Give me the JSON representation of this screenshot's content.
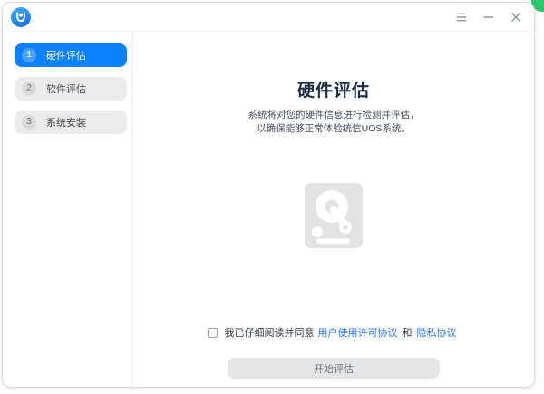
{
  "colors": {
    "accent_blue": "#0b81ff",
    "active_step_circle_blue": "#4aa0ff",
    "link_blue": "#2878ff",
    "inactive_step_bg": "#ebebeb",
    "disabled_button_bg": "#e4e5e7",
    "disabled_button_text": "#6e7683",
    "window_bg": "#ffffff",
    "artifact_green": "#2fc76d"
  },
  "titlebar": {
    "logo_icon": "uos-logo-icon",
    "menu_icon": "menu-icon",
    "minimize_icon": "minimize-icon",
    "close_icon": "close-icon"
  },
  "sidebar": {
    "steps": [
      {
        "number": "1",
        "label": "硬件评估",
        "state": "active"
      },
      {
        "number": "2",
        "label": "软件评估",
        "state": "inactive"
      },
      {
        "number": "3",
        "label": "系统安装",
        "state": "inactive"
      }
    ]
  },
  "main": {
    "title": "硬件评估",
    "description": [
      "系统将对您的硬件信息进行检测并评估，",
      "以确保能够正常体验统信UOS系统。"
    ],
    "center_icon": "hard-drive-search-icon",
    "agreement": {
      "checked": false,
      "prefix": "我已仔细阅读并同意",
      "license_link": "用户使用许可协议",
      "conjunction": "和",
      "privacy_link": "隐私协议"
    },
    "start_button_label": "开始评估",
    "start_button_enabled": false
  }
}
